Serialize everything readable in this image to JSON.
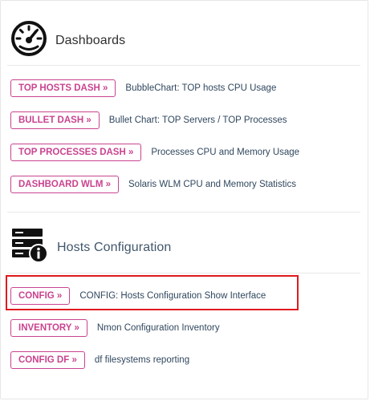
{
  "dashboards": {
    "title": "Dashboards",
    "icon": "speedometer-icon",
    "items": [
      {
        "button": "TOP HOSTS DASH »",
        "description": "BubbleChart: TOP hosts CPU Usage"
      },
      {
        "button": "BULLET DASH »",
        "description": "Bullet Chart: TOP Servers / TOP Processes"
      },
      {
        "button": "TOP PROCESSES DASH »",
        "description": "Processes CPU and Memory Usage"
      },
      {
        "button": "DASHBOARD WLM »",
        "description": "Solaris WLM CPU and Memory Statistics"
      }
    ]
  },
  "hosts_configuration": {
    "title": "Hosts Configuration",
    "icon": "server-info-icon",
    "items": [
      {
        "button": "CONFIG »",
        "description": "CONFIG: Hosts Configuration Show Interface"
      },
      {
        "button": "INVENTORY »",
        "description": "Nmon Configuration Inventory"
      },
      {
        "button": "CONFIG DF »",
        "description": "df filesystems reporting"
      }
    ]
  },
  "colors": {
    "button_accent": "#c9438f",
    "description_text": "#30475e",
    "highlight_border": "#e1191f"
  }
}
